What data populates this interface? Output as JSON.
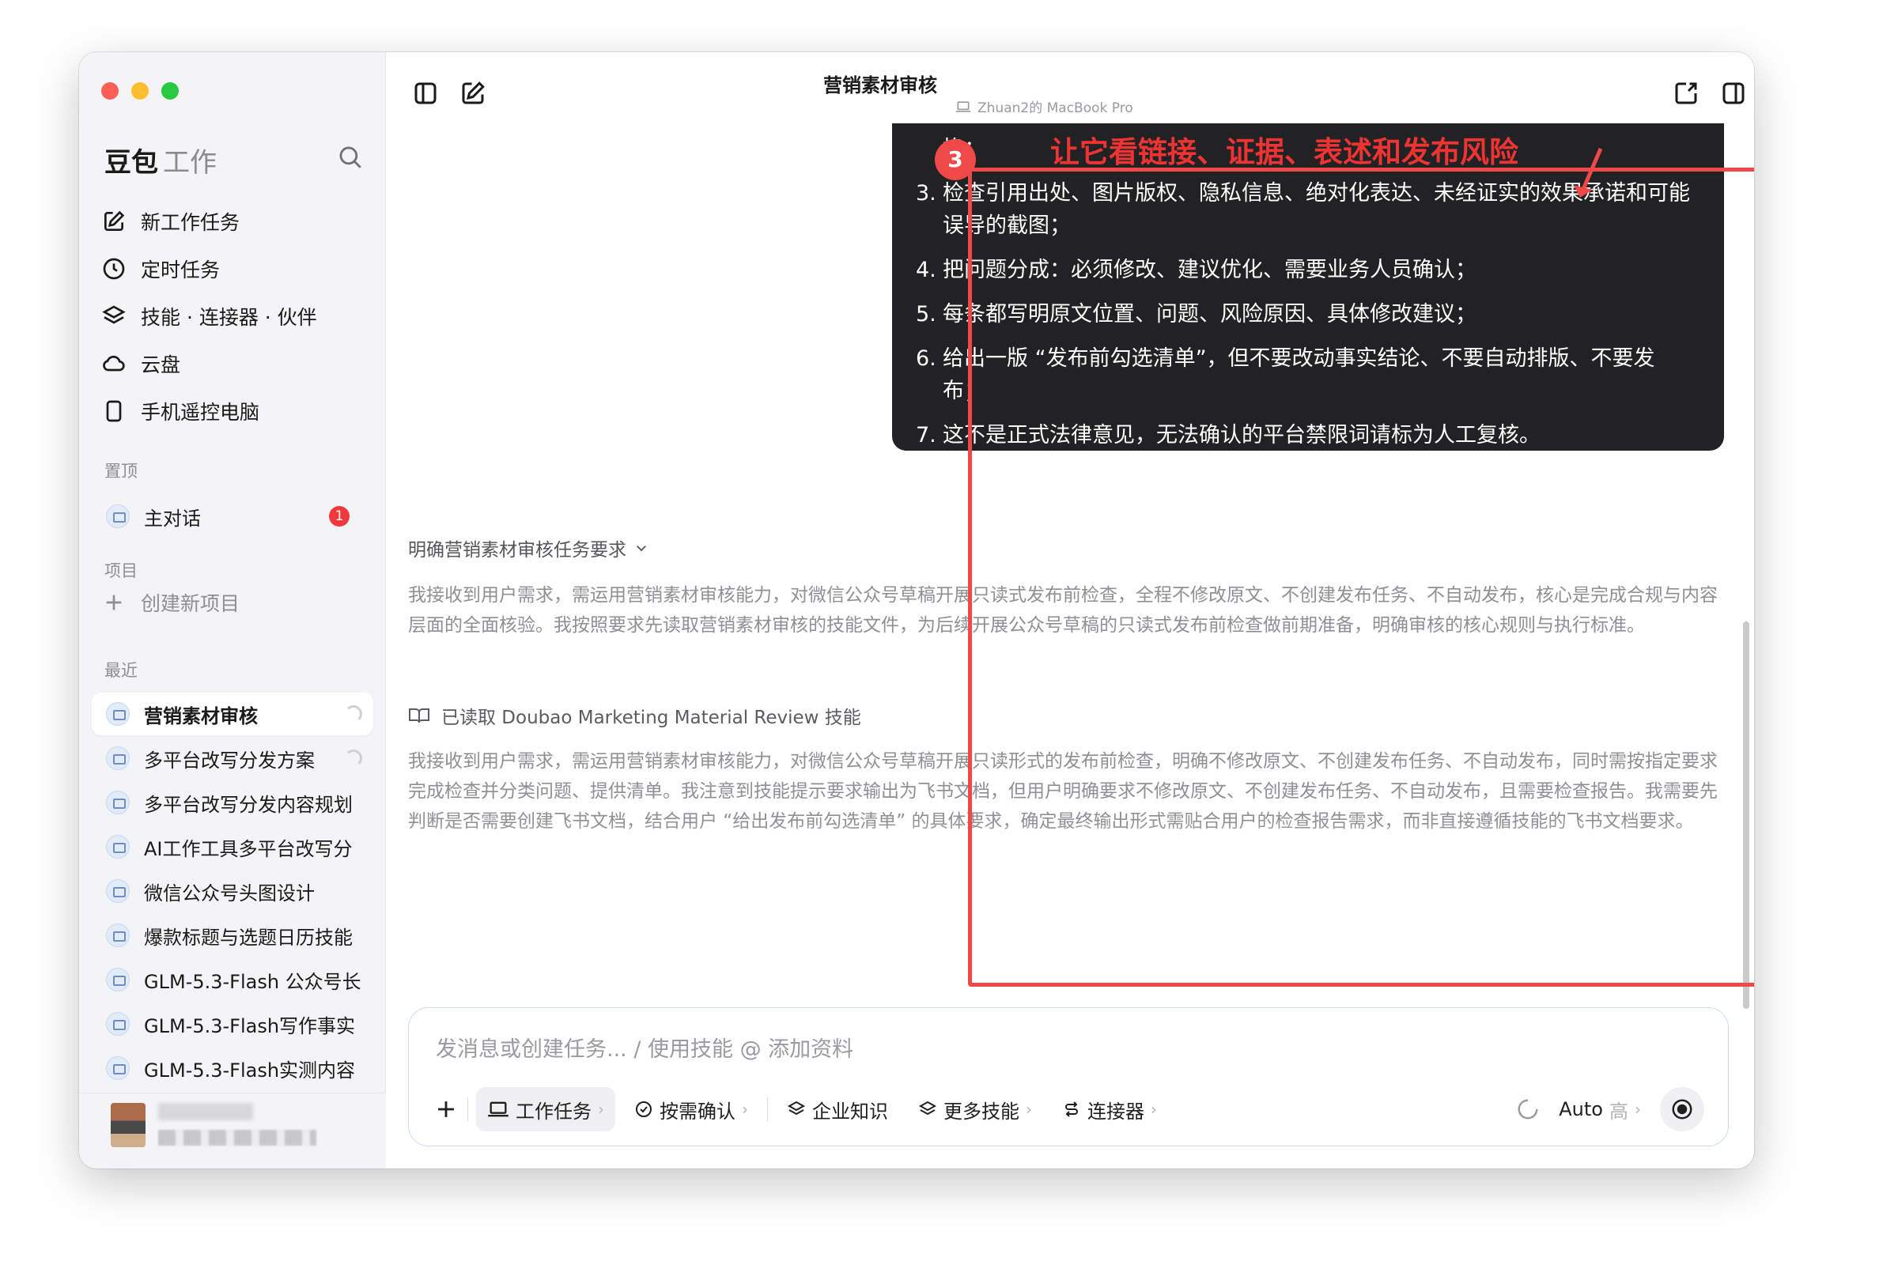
{
  "sidebar": {
    "brand_main": "豆包",
    "brand_sub": "工作",
    "nav": [
      {
        "label": "新工作任务",
        "icon": "edit-icon"
      },
      {
        "label": "定时任务",
        "icon": "clock-icon"
      },
      {
        "label": "技能 · 连接器 · 伙伴",
        "icon": "layers-icon"
      },
      {
        "label": "云盘",
        "icon": "cloud-icon"
      },
      {
        "label": "手机遥控电脑",
        "icon": "phone-icon"
      }
    ],
    "pinned_label": "置顶",
    "pinned_item": {
      "label": "主对话",
      "badge": "1"
    },
    "projects_label": "项目",
    "new_project_label": "创建新项目",
    "recent_label": "最近",
    "recent": [
      {
        "label": "营销素材审核"
      },
      {
        "label": "多平台改写分发方案"
      },
      {
        "label": "多平台改写分发内容规划"
      },
      {
        "label": "AI工作工具多平台改写分"
      },
      {
        "label": "微信公众号头图设计"
      },
      {
        "label": "爆款标题与选题日历技能"
      },
      {
        "label": "GLM-5.3-Flash 公众号长"
      },
      {
        "label": "GLM-5.3-Flash写作事实"
      },
      {
        "label": "GLM-5.3-Flash实测内容"
      }
    ]
  },
  "header": {
    "title": "营销素材审核",
    "subtitle": "Zhuan2的 MacBook Pro"
  },
  "request": {
    "items": [
      {
        "num": "",
        "text": "换；"
      },
      {
        "num": "3.",
        "text": "检查引用出处、图片版权、隐私信息、绝对化表达、未经证实的效果承诺和可能误导的截图；"
      },
      {
        "num": "4.",
        "text": "把问题分成：必须修改、建议优化、需要业务人员确认；"
      },
      {
        "num": "5.",
        "text": "每条都写明原文位置、问题、风险原因、具体修改建议；"
      },
      {
        "num": "6.",
        "text": "给出一版 “发布前勾选清单”，但不要改动事实结论、不要自动排版、不要发布；"
      },
      {
        "num": "7.",
        "text": "这不是正式法律意见，无法确认的平台禁限词请标为人工复核。"
      }
    ]
  },
  "thinking": {
    "title": "明确营销素材审核任务要求",
    "para1": "我接收到用户需求，需运用营销素材审核能力，对微信公众号草稿开展只读式发布前检查，全程不修改原文、不创建发布任务、不自动发布，核心是完成合规与内容层面的全面核验。我按照要求先读取营销素材审核的技能文件，为后续开展公众号草稿的只读式发布前检查做前期准备，明确审核的核心规则与执行标准。",
    "read_label": "已读取 Doubao Marketing Material Review 技能",
    "para2": "我接收到用户需求，需运用营销素材审核能力，对微信公众号草稿开展只读形式的发布前检查，明确不修改原文、不创建发布任务、不自动发布，同时需按指定要求完成检查并分类问题、提供清单。我注意到技能提示要求输出为飞书文档，但用户明确要求不修改原文、不创建发布任务、不自动发布，且需要检查报告。我需要先判断是否需要创建飞书文档，结合用户 “给出发布前勾选清单” 的具体要求，确定最终输出形式需贴合用户的检查报告需求，而非直接遵循技能的飞书文档要求。"
  },
  "input": {
    "placeholder": "发消息或创建任务... / 使用技能 @ 添加资料",
    "chips": {
      "task": "工作任务",
      "confirm": "按需确认",
      "knowledge": "企业知识",
      "skills": "更多技能",
      "connectors": "连接器"
    },
    "model": "Auto",
    "level": "高"
  },
  "annotation": {
    "number": "3",
    "text": "让它看链接、证据、表述和发布风险",
    "color": "#ee4848"
  }
}
